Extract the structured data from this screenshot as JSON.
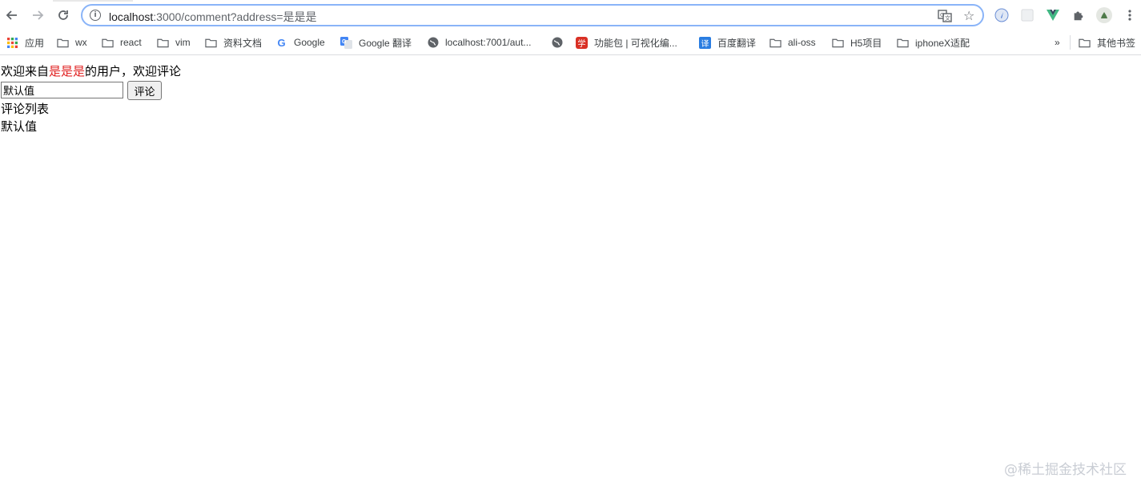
{
  "browser": {
    "url_host": "localhost",
    "url_rest": ":3000/comment?address=是是是",
    "bookmarks": [
      {
        "label": "应用",
        "icon": "apps-grid-icon"
      },
      {
        "label": "wx",
        "icon": "folder-icon"
      },
      {
        "label": "react",
        "icon": "folder-icon"
      },
      {
        "label": "vim",
        "icon": "folder-icon"
      },
      {
        "label": "资料文档",
        "icon": "folder-icon"
      },
      {
        "label": "Google",
        "icon": "google-icon"
      },
      {
        "label": "Google 翻译",
        "icon": "google-translate-icon"
      },
      {
        "label": "localhost:7001/aut...",
        "icon": "globe-icon"
      },
      {
        "label": "",
        "icon": "globe-icon"
      },
      {
        "label": "功能包 | 可视化编...",
        "icon": "xue-icon"
      },
      {
        "label": "百度翻译",
        "icon": "baidu-translate-icon"
      },
      {
        "label": "ali-oss",
        "icon": "folder-icon"
      },
      {
        "label": "H5项目",
        "icon": "folder-icon"
      },
      {
        "label": "iphoneX适配",
        "icon": "folder-icon"
      }
    ],
    "more_label": "»",
    "other_bookmarks": "其他书签"
  },
  "page": {
    "welcome_prefix": "欢迎来自",
    "welcome_address": "是是是",
    "welcome_suffix": "的用户，欢迎评论",
    "input_value": "默认值",
    "submit_label": "评论",
    "list_title": "评论列表",
    "comments": [
      "默认值"
    ]
  },
  "watermark": "@稀土掘金技术社区",
  "colors": {
    "address_highlight": "#e02020",
    "omnibox_focus": "#8ab4f8"
  }
}
